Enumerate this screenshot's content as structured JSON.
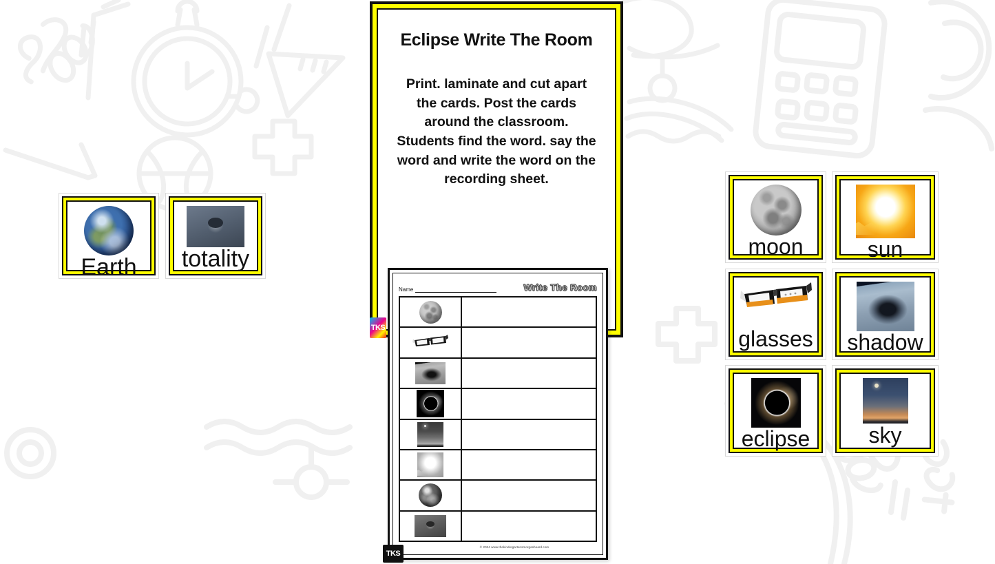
{
  "background": {
    "doodles": [
      "school-script",
      "clock",
      "ruler-triangle",
      "plus",
      "notebook",
      "globe",
      "calculator",
      "spiral-notebook",
      "back-to-school-script",
      "basketball",
      "pencil"
    ],
    "color": "#f0f0f0"
  },
  "title_card": {
    "heading": "Eclipse Write The Room",
    "body": "Print. laminate and cut apart the cards.  Post the cards around the classroom.  Students find the word. say the word and write the word on the recording sheet.",
    "frame_color": "#ffff00",
    "badge": "TKS"
  },
  "left_cards": [
    {
      "word": "Earth",
      "image": "earth-globe"
    },
    {
      "word": "totality",
      "image": "totality-eclipse"
    }
  ],
  "right_cards": [
    {
      "word": "moon",
      "image": "full-moon"
    },
    {
      "word": "sun",
      "image": "bright-sun"
    },
    {
      "word": "glasses",
      "image": "eclipse-glasses"
    },
    {
      "word": "shadow",
      "image": "earth-shadow-from-space"
    },
    {
      "word": "eclipse",
      "image": "total-solar-eclipse"
    },
    {
      "word": "sky",
      "image": "twilight-sky"
    }
  ],
  "worksheet": {
    "name_label": "Name",
    "title": "Write The Room",
    "rows": [
      {
        "image": "full-moon"
      },
      {
        "image": "eclipse-glasses"
      },
      {
        "image": "earth-shadow-from-space"
      },
      {
        "image": "total-solar-eclipse"
      },
      {
        "image": "twilight-sky"
      },
      {
        "image": "bright-sun"
      },
      {
        "image": "earth-globe"
      },
      {
        "image": "totality-eclipse"
      }
    ],
    "copyright": "© 2024 www.thekindergartensmorgasboard.com",
    "badge": "TKS"
  }
}
